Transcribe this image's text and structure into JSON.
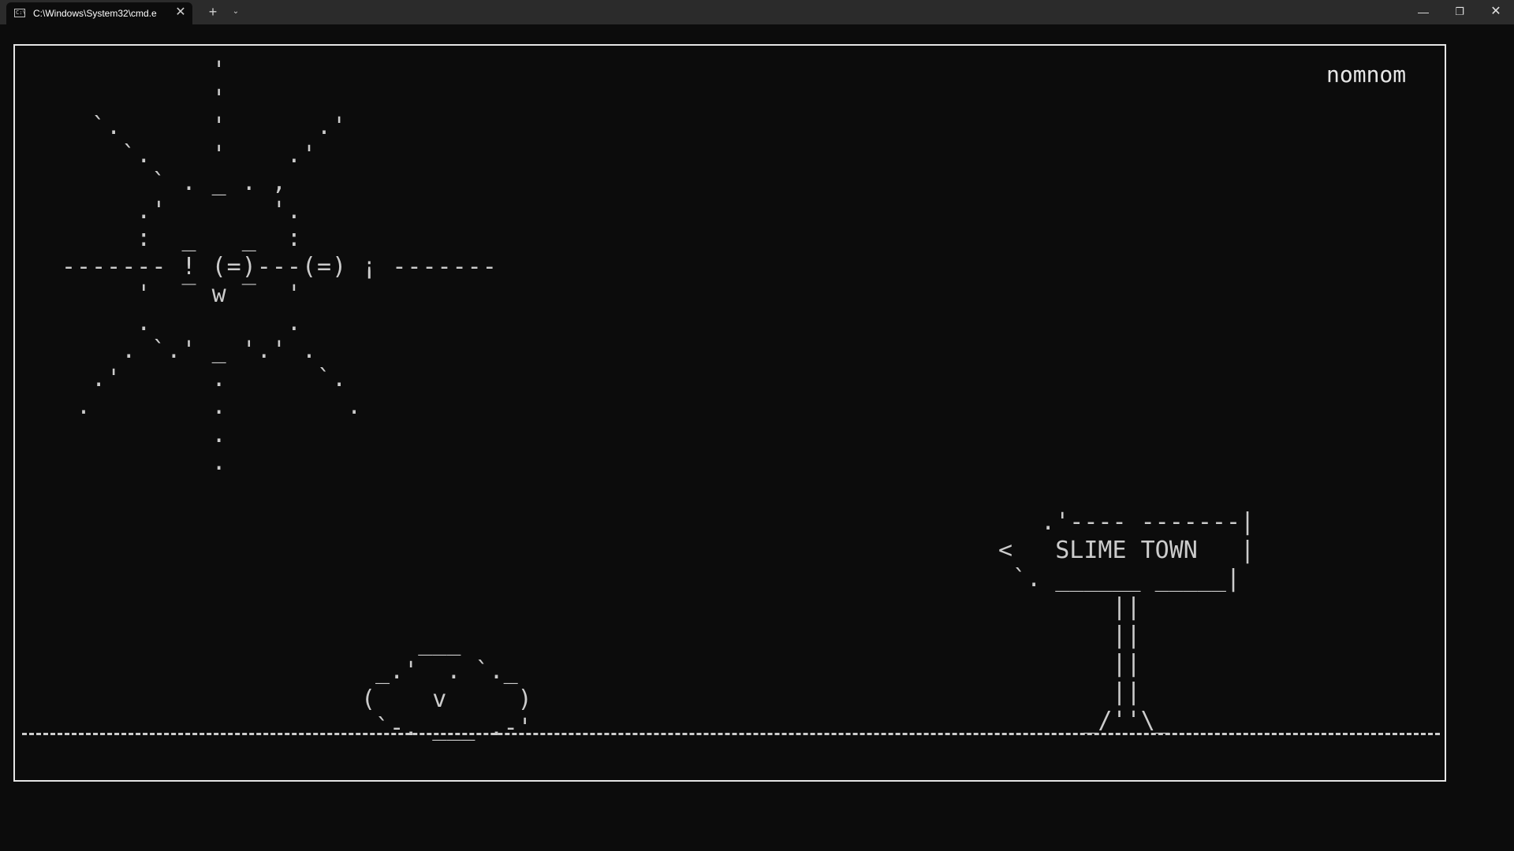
{
  "window": {
    "tab_title": "C:\\Windows\\System32\\cmd.e",
    "tab_icon": "terminal-icon",
    "close_glyph": "✕",
    "new_tab_glyph": "+",
    "dropdown_glyph": "⌄",
    "minimize_glyph": "—",
    "maximize_glyph": "❐",
    "window_close_glyph": "✕"
  },
  "terminal": {
    "label": "nomnom",
    "sun_art": "          '\n          '\n  `.      '      .'\n    `.    '    .'\n      ` . _ . ,\n     .'       '.\n     :  _   _  :\n------- ! (=)---(=) ¡ -------\n     '  ‾ w ‾  '\n     .         .\n    . `.' _ '.' .\n  .'      .      `.\n .        .        .\n          .\n          .",
    "slime_art": "    ___\n _.'  . `._\n(    v     )\n `-. ___ .-'",
    "sign_art": "   .'---- -------|\n<   SLIME TOWN   |\n `. ______ _____|\n        ||\n        ||\n        ||\n        ||\n      _/''\\_",
    "ground_art": "------------------------------------------------------------------------------------------"
  },
  "colors": {
    "background": "#0c0c0c",
    "foreground": "#cccccc",
    "titlebar": "#2b2b2b"
  }
}
